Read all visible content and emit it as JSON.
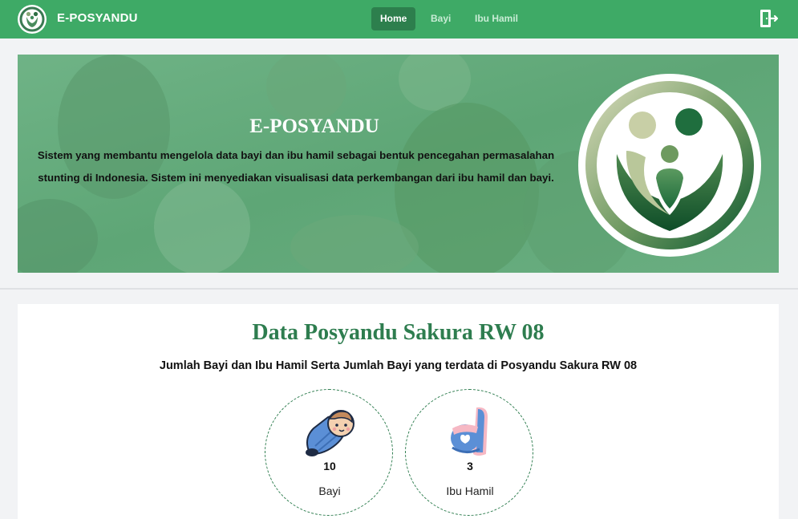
{
  "brand": {
    "name": "E-POSYANDU",
    "logo_icon": "posyandu-family-logo-icon"
  },
  "nav": {
    "items": [
      {
        "label": "Home",
        "active": true
      },
      {
        "label": "Bayi",
        "active": false
      },
      {
        "label": "Ibu Hamil",
        "active": false
      }
    ],
    "logout_icon": "logout-door-icon"
  },
  "hero": {
    "title": "E-POSYANDU",
    "description": "Sistem yang membantu mengelola data bayi dan ibu hamil sebagai bentuk pencegahan permasalahan stunting di Indonesia. Sistem ini menyediakan visualisasi data perkembangan dari ibu hamil dan bayi."
  },
  "data_section": {
    "title": "Data Posyandu Sakura RW 08",
    "subtitle": "Jumlah Bayi dan Ibu Hamil Serta Jumlah Bayi yang terdata di Posyandu Sakura RW 08",
    "stats": [
      {
        "icon": "baby-icon",
        "value": "10",
        "label": "Bayi"
      },
      {
        "icon": "pregnant-woman-icon",
        "value": "3",
        "label": "Ibu Hamil"
      }
    ]
  },
  "colors": {
    "primary_green": "#3eaa66",
    "active_nav": "#2d7f4d",
    "title_green": "#2e7d4f"
  }
}
